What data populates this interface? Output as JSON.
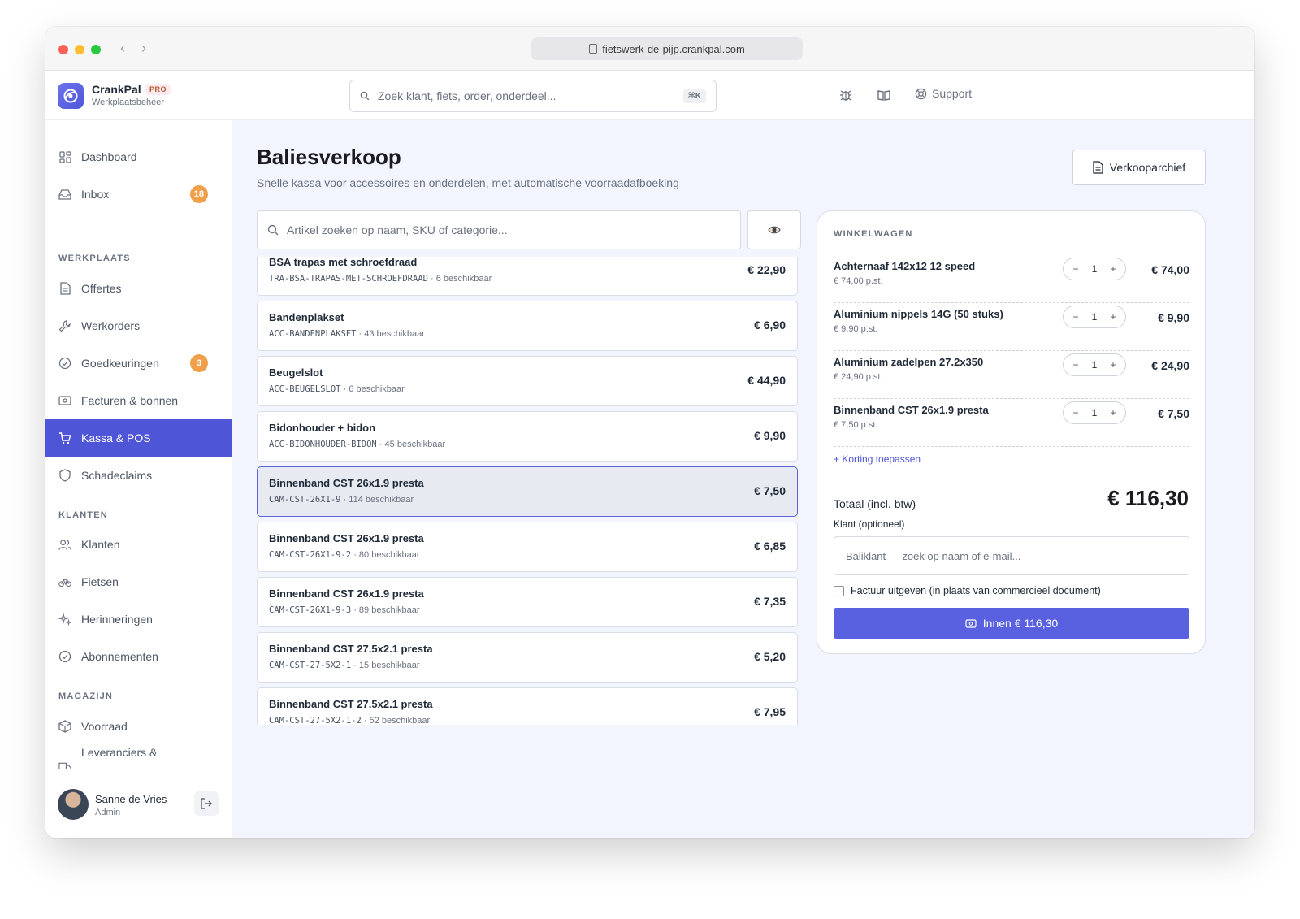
{
  "browser": {
    "url": "fietswerk-de-pijp.crankpal.com"
  },
  "app": {
    "name": "CrankPal",
    "tier": "PRO",
    "subtitle": "Werkplaatsbeheer"
  },
  "header": {
    "search_placeholder": "Zoek klant, fiets, order, onderdeel...",
    "shortcut": "⌘K",
    "support_label": "Support"
  },
  "sidebar": {
    "dashboard": "Dashboard",
    "inbox": "Inbox",
    "inbox_count": "18",
    "section_werkplaats": "WERKPLAATS",
    "offertes": "Offertes",
    "werkorders": "Werkorders",
    "goedkeuringen": "Goedkeuringen",
    "goedkeuringen_count": "3",
    "facturen": "Facturen & bonnen",
    "kassa": "Kassa & POS",
    "schadeclaims": "Schadeclaims",
    "section_klanten": "KLANTEN",
    "klanten": "Klanten",
    "fietsen": "Fietsen",
    "herinneringen": "Herinneringen",
    "abonnementen": "Abonnementen",
    "section_magazijn": "MAGAZIJN",
    "voorraad": "Voorraad",
    "leveranciers": "Leveranciers &"
  },
  "user": {
    "name": "Sanne de Vries",
    "role": "Admin"
  },
  "page": {
    "title": "Baliesverkoop",
    "subtitle": "Snelle kassa voor accessoires en onderdelen, met automatische voorraadafboeking",
    "archive_button": "Verkooparchief",
    "search_placeholder": "Artikel zoeken op naam, SKU of categorie..."
  },
  "products": [
    {
      "name": "BSA trapas met schroefdraad",
      "sku": "TRA-BSA-TRAPAS-MET-SCHROEFDRAAD",
      "stock": " · 6 beschikbaar",
      "price": "€ 22,90"
    },
    {
      "name": "Bandenplakset",
      "sku": "ACC-BANDENPLAKSET",
      "stock": " · 43 beschikbaar",
      "price": "€ 6,90"
    },
    {
      "name": "Beugelslot",
      "sku": "ACC-BEUGELSLOT",
      "stock": " · 6 beschikbaar",
      "price": "€ 44,90"
    },
    {
      "name": "Bidonhouder + bidon",
      "sku": "ACC-BIDONHOUDER-BIDON",
      "stock": " · 45 beschikbaar",
      "price": "€ 9,90"
    },
    {
      "name": "Binnenband CST 26x1.9 presta",
      "sku": "CAM-CST-26X1-9",
      "stock": " · 114 beschikbaar",
      "price": "€ 7,50"
    },
    {
      "name": "Binnenband CST 26x1.9 presta",
      "sku": "CAM-CST-26X1-9-2",
      "stock": " · 80 beschikbaar",
      "price": "€ 6,85"
    },
    {
      "name": "Binnenband CST 26x1.9 presta",
      "sku": "CAM-CST-26X1-9-3",
      "stock": " · 89 beschikbaar",
      "price": "€ 7,35"
    },
    {
      "name": "Binnenband CST 27.5x2.1 presta",
      "sku": "CAM-CST-27-5X2-1",
      "stock": " · 15 beschikbaar",
      "price": "€ 5,20"
    },
    {
      "name": "Binnenband CST 27.5x2.1 presta",
      "sku": "CAM-CST-27-5X2-1-2",
      "stock": " · 52 beschikbaar",
      "price": "€ 7,95"
    }
  ],
  "cart": {
    "title": "WINKELWAGEN",
    "items": [
      {
        "name": "Achternaaf 142x12 12 speed",
        "unit": "€ 74,00 p.st.",
        "qty": "1",
        "total": "€ 74,00"
      },
      {
        "name": "Aluminium nippels 14G (50 stuks)",
        "unit": "€ 9,90 p.st.",
        "qty": "1",
        "total": "€ 9,90"
      },
      {
        "name": "Aluminium zadelpen 27.2x350",
        "unit": "€ 24,90 p.st.",
        "qty": "1",
        "total": "€ 24,90"
      },
      {
        "name": "Binnenband CST 26x1.9 presta",
        "unit": "€ 7,50 p.st.",
        "qty": "1",
        "total": "€ 7,50"
      }
    ],
    "discount_link": "+ Korting toepassen",
    "total_label": "Totaal (incl. btw)",
    "total_value": "€ 116,30",
    "customer_label": "Klant (optioneel)",
    "customer_placeholder": "Baliklant — zoek op naam of e-mail...",
    "invoice_label": "Factuur uitgeven (in plaats van commercieel document)",
    "pay_button": "Innen € 116,30"
  },
  "colors": {
    "accent": "#4e55d6",
    "badge": "#f0a04b",
    "main_bg": "#f2f5fd"
  }
}
